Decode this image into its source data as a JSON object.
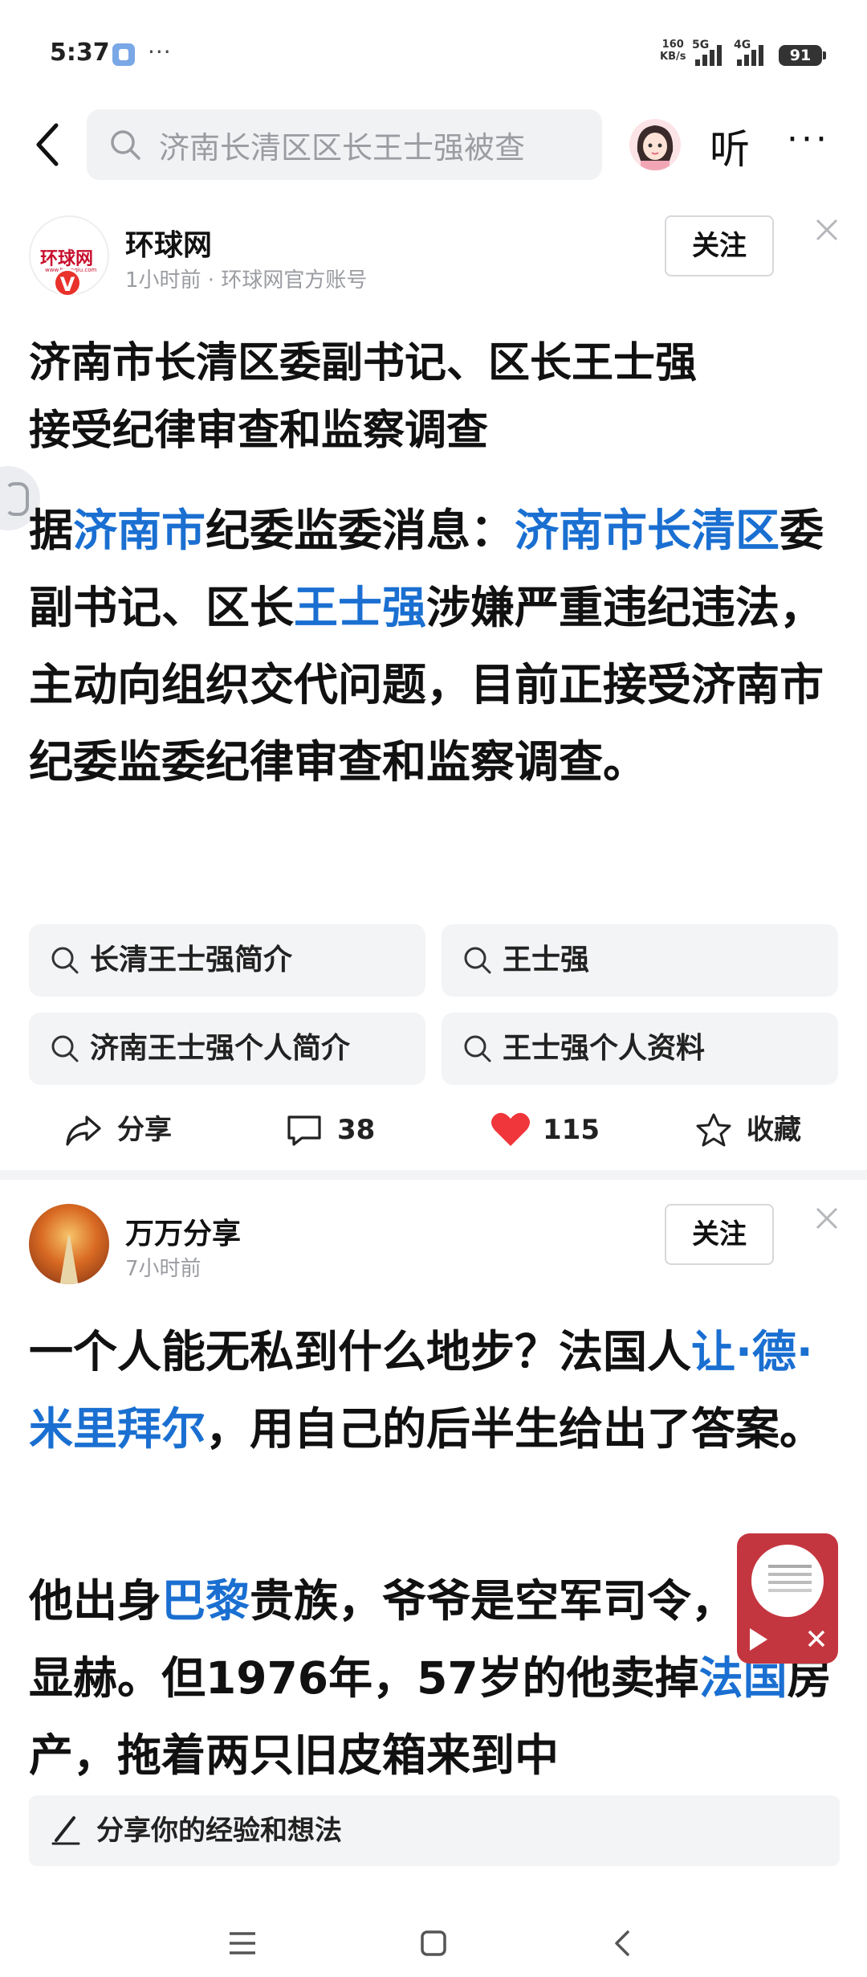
{
  "status_bar": {
    "time": "5:37",
    "dots": "···",
    "net_speed_value": "160",
    "net_speed_unit": "KB/s",
    "signal_1": "5G",
    "signal_2": "4G",
    "battery": "91"
  },
  "nav": {
    "search_query": "济南长清区区长王士强被查",
    "listen_label": "听",
    "more_label": "···"
  },
  "article1": {
    "source_name": "环球网",
    "source_logo_text": "环球网",
    "source_logo_sub": "www.huanqiu.com",
    "verified_badge": "V",
    "meta": "1小时前 · 环球网官方账号",
    "follow_label": "关注",
    "title_line1": "济南市长清区委副书记、区长王士强",
    "title_line2": "接受纪律审查和监察调查",
    "body": {
      "p1": "据",
      "l1": "济南市",
      "p2": "纪委监委消息：",
      "l2": "济南市长清区",
      "p3": "委副书记、区长",
      "l3": "王士强",
      "p4": "涉嫌严重违纪违法，主动向组织交代问题，目前正接受济南市纪委监委纪律审查和监察调查。"
    },
    "suggestions": [
      "长清王士强简介",
      "王士强",
      "济南王士强个人简介",
      "王士强个人资料"
    ],
    "actions": {
      "share": "分享",
      "comments": "38",
      "likes": "115",
      "favorite": "收藏"
    }
  },
  "article2": {
    "author_name": "万万分享",
    "meta": "7小时前",
    "follow_label": "关注",
    "para1": {
      "p1": "一个人能无私到什么地步？法国人",
      "l1": "让·德·米里拜尔",
      "p2": "，用自己的后半生给出了答案。"
    },
    "para2": {
      "p1": "他出身",
      "l1": "巴黎",
      "p2": "贵族，爷爷是空军司令，家世显赫。但1976年，57岁的他卖掉",
      "l2": "法国",
      "p3": "房产，拖着两只旧皮箱来到中"
    }
  },
  "comment_bar": {
    "placeholder": "分享你的经验和想法"
  },
  "colors": {
    "link": "#1a6fd1",
    "like_heart": "#f0353b",
    "verify_badge": "#e8322b",
    "float_video": "#c4363f"
  }
}
